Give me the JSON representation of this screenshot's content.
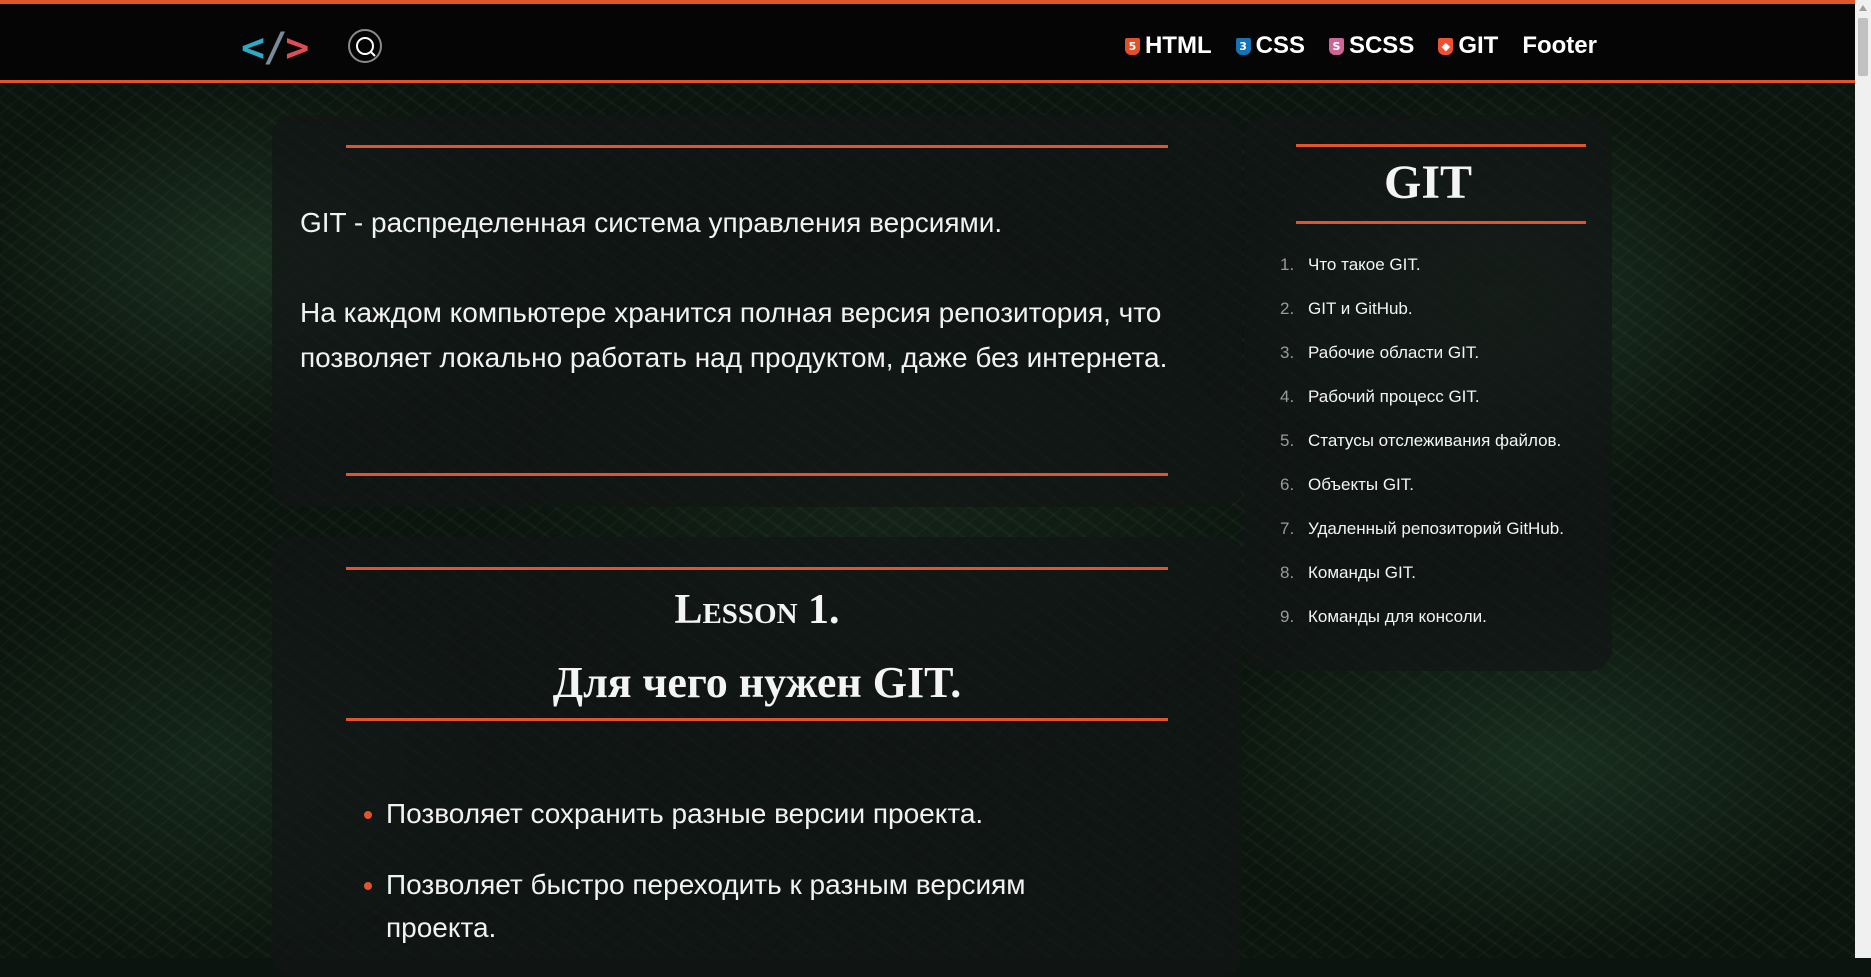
{
  "header": {
    "logo": {
      "left": "<",
      "slash": "/",
      "right": ">"
    },
    "nav": [
      {
        "label": "HTML",
        "icon": "html5-icon",
        "icon_glyph": "5",
        "icon_color": "#e34f26"
      },
      {
        "label": "CSS",
        "icon": "css3-icon",
        "icon_glyph": "3",
        "icon_color": "#1572b6"
      },
      {
        "label": "SCSS",
        "icon": "sass-icon",
        "icon_glyph": "S",
        "icon_color": "#cc6699"
      },
      {
        "label": "GIT",
        "icon": "git-icon",
        "icon_glyph": "◆",
        "icon_color": "#f05032"
      },
      {
        "label": "Footer",
        "icon": "",
        "icon_glyph": "",
        "icon_color": ""
      }
    ]
  },
  "intro": {
    "paragraph_1": "GIT - распределенная система управления версиями.",
    "paragraph_2": "На каждом компьютере хранится полная версия репозитория, что позволяет локально работать над продуктом, даже без интернета."
  },
  "lesson": {
    "number": "Lesson 1.",
    "title": "Для чего нужен GIT.",
    "bullets": [
      "Позволяет сохранить разные версии проекта.",
      "Позволяет быстро переходить к разным версиям проекта."
    ]
  },
  "toc": {
    "title": "GIT",
    "items": [
      {
        "num": "1.",
        "label": "Что такое GIT."
      },
      {
        "num": "2.",
        "label": "GIT и GitHub."
      },
      {
        "num": "3.",
        "label": "Рабочие области GIT."
      },
      {
        "num": "4.",
        "label": "Рабочий процесс GIT."
      },
      {
        "num": "5.",
        "label": "Статусы отслеживания файлов."
      },
      {
        "num": "6.",
        "label": "Объекты GIT."
      },
      {
        "num": "7.",
        "label": "Удаленный репозиторий GitHub."
      },
      {
        "num": "8.",
        "label": "Команды GIT."
      },
      {
        "num": "9.",
        "label": "Команды для консоли."
      }
    ]
  },
  "colors": {
    "accent": "#e0562a",
    "card": "#121616",
    "text": "#ffffff"
  }
}
